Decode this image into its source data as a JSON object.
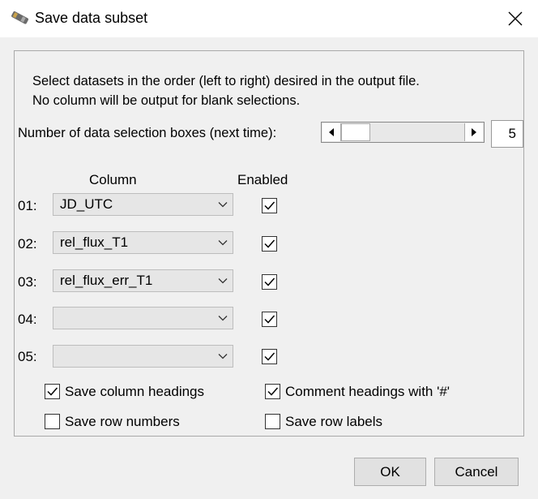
{
  "window": {
    "title": "Save data subset"
  },
  "instructions": {
    "line1": "Select datasets in the order (left to right) desired in the output file.",
    "line2": "No column will be output for blank selections."
  },
  "selection_boxes": {
    "label": "Number of data selection boxes (next time):",
    "value": "5"
  },
  "headers": {
    "column": "Column",
    "enabled": "Enabled"
  },
  "rows": [
    {
      "label": "01:",
      "value": "JD_UTC",
      "enabled": true
    },
    {
      "label": "02:",
      "value": "rel_flux_T1",
      "enabled": true
    },
    {
      "label": "03:",
      "value": "rel_flux_err_T1",
      "enabled": true
    },
    {
      "label": "04:",
      "value": "",
      "enabled": true
    },
    {
      "label": "05:",
      "value": "",
      "enabled": true
    }
  ],
  "options": {
    "save_column_headings": {
      "label": "Save column headings",
      "checked": true
    },
    "comment_headings": {
      "label": "Comment headings with '#'",
      "checked": true
    },
    "save_row_numbers": {
      "label": "Save row numbers",
      "checked": false
    },
    "save_row_labels": {
      "label": "Save row labels",
      "checked": false
    }
  },
  "buttons": {
    "ok": "OK",
    "cancel": "Cancel"
  },
  "icons": {
    "window": "telescope-icon",
    "close": "close-icon"
  }
}
